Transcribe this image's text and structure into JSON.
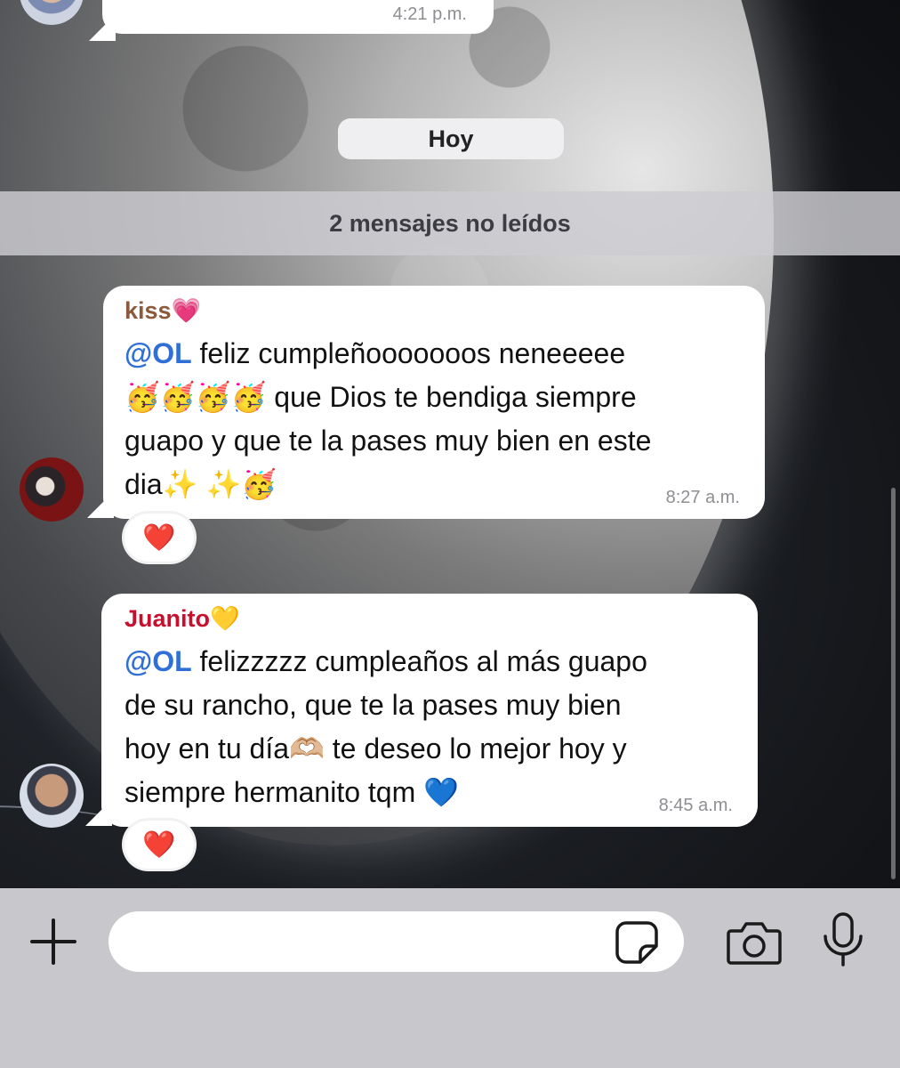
{
  "previous_message": {
    "time": "4:21 p.m."
  },
  "date_chip": "Hoy",
  "unread_banner": "2 mensajes no leídos",
  "messages": [
    {
      "sender": "kiss💗",
      "sender_color": "#8b5a3c",
      "mention": "@OL",
      "lines": [
        " feliz cumpleñooooooos neneeeee",
        "🥳🥳🥳🥳 que Dios te bendiga siempre",
        "guapo y que te la pases muy bien en este",
        "dia✨ ✨🥳"
      ],
      "time": "8:27 a.m.",
      "reaction": "❤️"
    },
    {
      "sender": "Juanito💛",
      "sender_color": "#c8102e",
      "mention": "@OL",
      "lines": [
        " felizzzzz cumpleaños al más guapo",
        "de su rancho, que te la pases muy bien",
        "hoy en tu día🫶🏼 te deseo lo mejor hoy y",
        "siempre hermanito tqm 💙"
      ],
      "time": "8:45 a.m.",
      "reaction": "❤️"
    }
  ],
  "composer": {
    "placeholder": ""
  },
  "icons": [
    "plus-icon",
    "sticker-icon",
    "camera-icon",
    "microphone-icon"
  ],
  "colors": {
    "mention": "#2f6fd6",
    "bubble": "#ffffff",
    "composer_bg": "#c8c8cc"
  }
}
